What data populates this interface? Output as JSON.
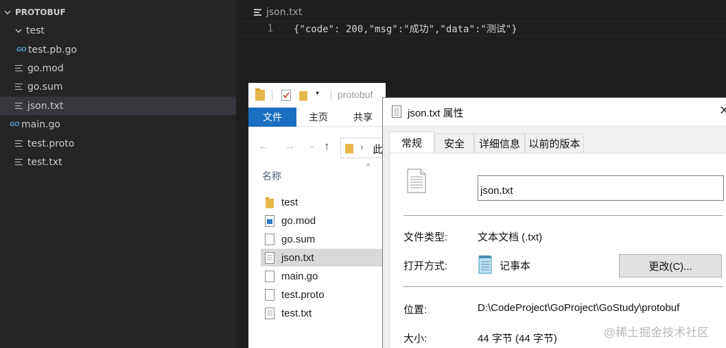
{
  "vscode": {
    "explorer": {
      "section_title": "PROTOBUF",
      "folder_name": "test",
      "go_badge": "GO",
      "items": [
        {
          "label": "test.pb.go"
        },
        {
          "label": "go.mod"
        },
        {
          "label": "go.sum"
        },
        {
          "label": "json.txt"
        },
        {
          "label": "main.go"
        },
        {
          "label": "test.proto"
        },
        {
          "label": "test.txt"
        }
      ]
    },
    "editor": {
      "breadcrumb": "json.txt",
      "line_number": "1",
      "line_text": "{\"code\": 200,\"msg\":\"成功\",\"data\":\"测试\"}"
    }
  },
  "file_explorer": {
    "title": "protobuf",
    "ribbon_tabs": [
      "文件",
      "主页",
      "共享"
    ],
    "address_partial": "此",
    "column_header": "名称",
    "files": [
      {
        "label": "test"
      },
      {
        "label": "go.mod"
      },
      {
        "label": "go.sum"
      },
      {
        "label": "json.txt"
      },
      {
        "label": "main.go"
      },
      {
        "label": "test.proto"
      },
      {
        "label": "test.txt"
      }
    ]
  },
  "properties_dialog": {
    "title": "json.txt 属性",
    "tabs": [
      "常规",
      "安全",
      "详细信息",
      "以前的版本"
    ],
    "file_name": "json.txt",
    "type_label": "文件类型:",
    "type_value": "文本文档 (.txt)",
    "opens_with_label": "打开方式:",
    "opens_with_value": "记事本",
    "change_button": "更改(C)...",
    "location_label": "位置:",
    "location_value": "D:\\CodeProject\\GoProject\\GoStudy\\protobuf",
    "size_label": "大小:",
    "size_value": "44 字节 (44 字节)"
  },
  "watermark": "@稀土掘金技术社区",
  "colors": {
    "vscode_sidebar_bg": "#252526",
    "vscode_editor_bg": "#1e1e1e",
    "vscode_selected_row": "#37373d",
    "go_icon": "#519aba",
    "ribbon_file_tab": "#1a6fc0",
    "folder_yellow": "#e8b74a"
  }
}
